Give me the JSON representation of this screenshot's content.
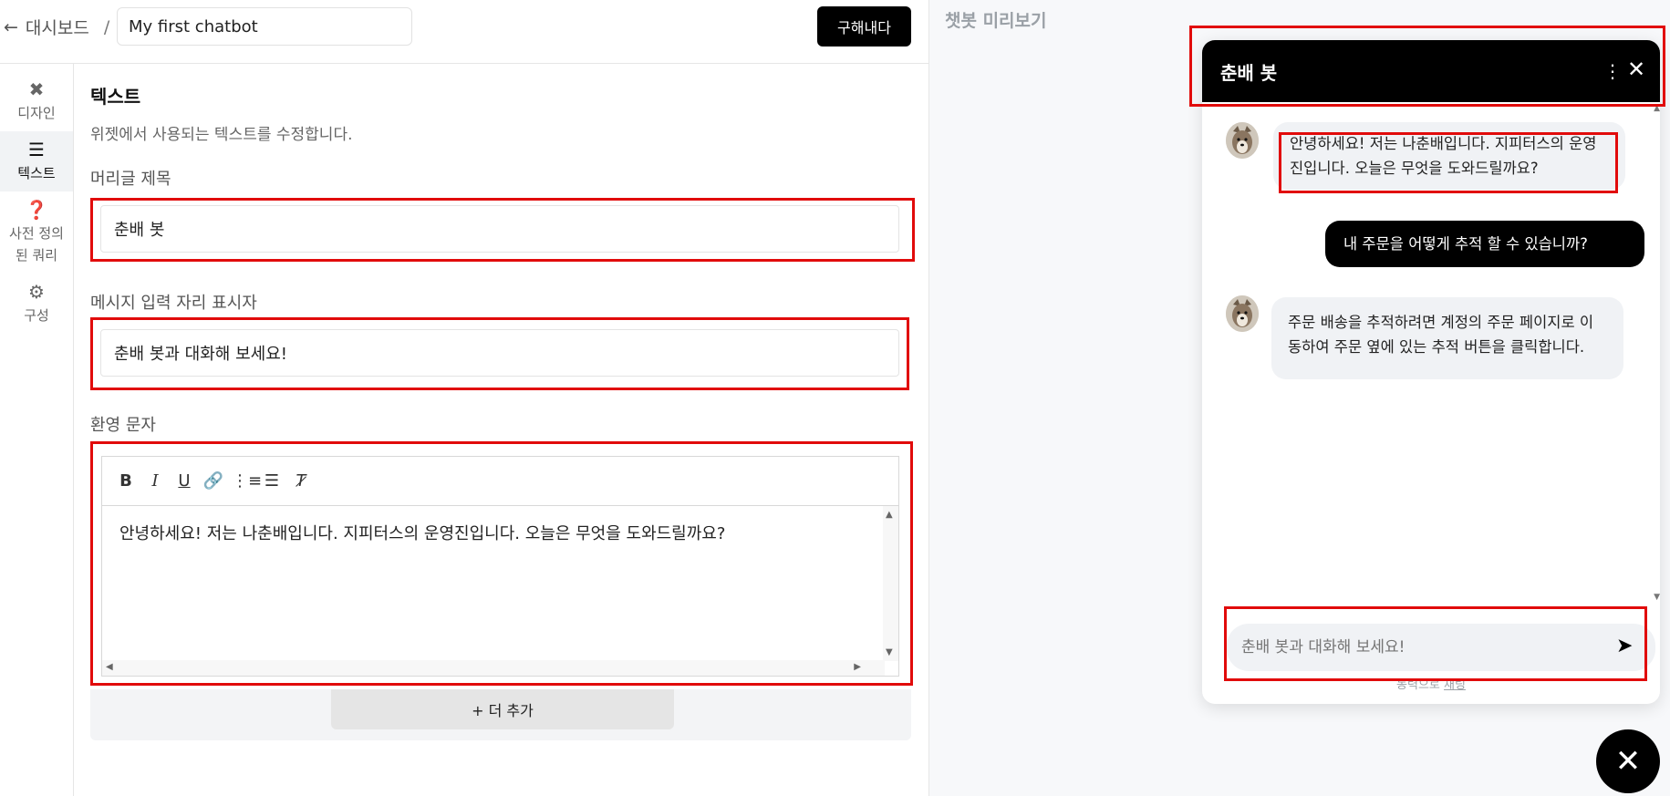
{
  "topbar": {
    "back_label": "대시보드",
    "separator": "/",
    "chatbot_name": "My first chatbot",
    "publish_label": "구해내다"
  },
  "sidebar": {
    "items": [
      {
        "icon": "design-icon",
        "label": "디자인",
        "active": false
      },
      {
        "icon": "text-icon",
        "label": "텍스트",
        "active": true
      },
      {
        "icon": "question-icon",
        "label_line1": "사전 정의",
        "label_line2": "된 쿼리",
        "active": false
      },
      {
        "icon": "gear-icon",
        "label": "구성",
        "active": false
      }
    ]
  },
  "panel": {
    "title": "텍스트",
    "description": "위젯에서 사용되는 텍스트를 수정합니다.",
    "header_title_label": "머리글 제목",
    "header_title_value": "춘배 봇",
    "placeholder_label": "메시지 입력 자리 표시자",
    "placeholder_value": "춘배 봇과 대화해 보세요!",
    "welcome_label": "환영 문자",
    "welcome_value": "안녕하세요! 저는 나춘배입니다. 지피터스의 운영진입니다. 오늘은 무엇을 도와드릴까요?",
    "add_more_label": "+ 더 추가"
  },
  "preview": {
    "title": "챗봇 미리보기",
    "chat_title": "춘배 봇",
    "messages": [
      {
        "role": "bot",
        "text": "안녕하세요! 저는 나춘배입니다. 지피터스의 운영진입니다. 오늘은 무엇을 도와드릴까요?"
      },
      {
        "role": "user",
        "text": "내 주문을 어떻게 추적 할 수 있습니까?"
      },
      {
        "role": "bot",
        "text": "주문 배송을 추적하려면 계정의 주문 페이지로 이동하여 주문 옆에 있는 추적 버튼을 클릭합니다."
      }
    ],
    "input_placeholder": "춘배 봇과 대화해 보세요!",
    "powered_prefix": "동력으로 ",
    "powered_brand": "채팅"
  },
  "colors": {
    "highlight": "#e10b0b",
    "accent": "#000000"
  }
}
